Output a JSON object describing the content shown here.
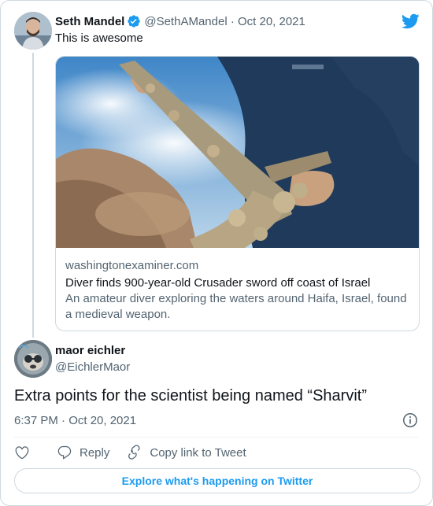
{
  "colors": {
    "accent": "#1d9bf0",
    "text_primary": "#0f1419",
    "text_secondary": "#536471",
    "border": "#cfd9de"
  },
  "parent_tweet": {
    "author_name": "Seth Mandel",
    "verified_icon": "verified-badge-icon",
    "handle_date": "@SethAMandel · Oct 20, 2021",
    "text": "This is awesome",
    "link_card": {
      "image_icon": "photo-diver-holding-sword",
      "domain": "washingtonexaminer.com",
      "title": "Diver finds 900-year-old Crusader sword off coast of Israel",
      "description": "An amateur diver exploring the waters around Haifa, Israel, found a medieval weapon."
    }
  },
  "main_tweet": {
    "author_name": "maor eichler",
    "handle": "@EichlerMaor",
    "text": "Extra points for the scientist being named “Sharvit”",
    "timestamp": "6:37 PM · Oct 20, 2021"
  },
  "actions": {
    "like_icon": "heart-icon",
    "reply_label": "Reply",
    "copy_label": "Copy link to Tweet"
  },
  "explore_button": "Explore what's happening on Twitter"
}
